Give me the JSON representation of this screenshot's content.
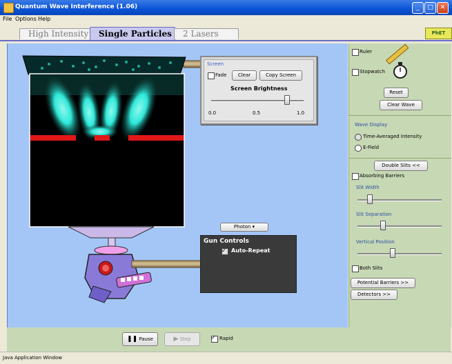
{
  "window": {
    "title": "Quantum Wave Interference (1.06)"
  },
  "menu": {
    "items": [
      "File",
      "Options",
      "Help"
    ]
  },
  "tabs": [
    {
      "label": "High Intensity",
      "active": false
    },
    {
      "label": "Single Particles",
      "active": true
    },
    {
      "label": "2 Lasers",
      "active": false
    }
  ],
  "logo_text": "PhET",
  "screen_panel": {
    "title": "Screen",
    "fade_label": "Fade",
    "clear_label": "Clear",
    "copy_screen_label": "Copy Screen",
    "brightness_title": "Screen Brightness",
    "brightness_ticks": [
      "0.0",
      "0.5",
      "1.0"
    ],
    "brightness_value": 0.82
  },
  "gun_panel": {
    "particle_select": "Photon",
    "title": "Gun Controls",
    "auto_repeat_label": "Auto-Repeat",
    "auto_repeat_checked": true
  },
  "right_panel": {
    "ruler_label": "Ruler",
    "stopwatch_label": "Stopwatch",
    "reset_label": "Reset",
    "clear_wave_label": "Clear Wave",
    "wave_display_title": "Wave Display",
    "wave_display_options": [
      "Time-Averaged Intensity",
      "E-Field"
    ],
    "double_slits_label": "Double Slits <<",
    "absorbing_barriers_label": "Absorbing Barriers",
    "slit_width_label": "Slit Width",
    "slit_width_value": 0.15,
    "slit_separation_label": "Slit Separation",
    "slit_separation_value": 0.3,
    "vertical_position_label": "Vertical Position",
    "vertical_position_value": 0.42,
    "both_slits_label": "Both Slits",
    "potential_barriers_label": "Potential Barriers >>",
    "detectors_label": "Detectors >>"
  },
  "playback": {
    "pause_label": "Pause",
    "step_label": "Step",
    "rapid_label": "Rapid"
  },
  "status_text": "Java Application Window",
  "colors": {
    "title_bar": "#0a53d6",
    "play_area": "#a3c6f7",
    "control_panel": "#c7d8b4",
    "slit_barrier": "#e01818",
    "wave": "#2ee8d8"
  }
}
